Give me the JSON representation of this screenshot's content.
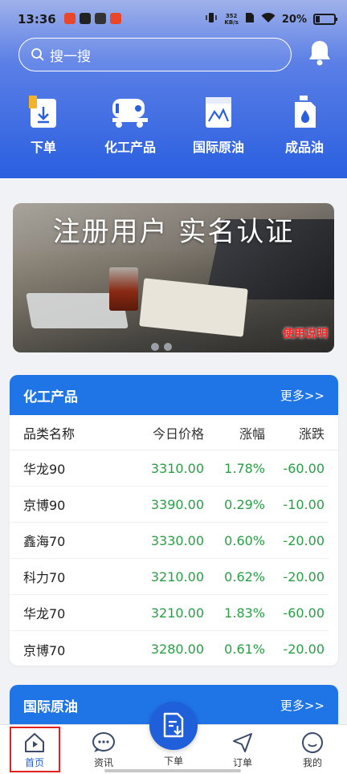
{
  "status_bar": {
    "time": "13:36",
    "net_speed": "352",
    "net_unit": "KB/s",
    "battery": "20%"
  },
  "search": {
    "placeholder": "搜一搜"
  },
  "quick_actions": [
    {
      "label": "下单",
      "icon": "order-document-icon"
    },
    {
      "label": "化工产品",
      "icon": "tanker-truck-icon"
    },
    {
      "label": "国际原油",
      "icon": "oil-chart-icon"
    },
    {
      "label": "成品油",
      "icon": "oil-can-icon"
    }
  ],
  "banner": {
    "title": "注册用户  实名认证",
    "guide_link": "使用说明"
  },
  "chemical": {
    "title": "化工产品",
    "more": "更多>>",
    "columns": [
      "品类名称",
      "今日价格",
      "涨幅",
      "涨跌"
    ],
    "rows": [
      {
        "name": "华龙90",
        "price": "3310.00",
        "pct": "1.78%",
        "change": "-60.00"
      },
      {
        "name": "京博90",
        "price": "3390.00",
        "pct": "0.29%",
        "change": "-10.00"
      },
      {
        "name": "鑫海70",
        "price": "3330.00",
        "pct": "0.60%",
        "change": "-20.00"
      },
      {
        "name": "科力70",
        "price": "3210.00",
        "pct": "0.62%",
        "change": "-20.00"
      },
      {
        "name": "华龙70",
        "price": "3210.00",
        "pct": "1.83%",
        "change": "-60.00"
      },
      {
        "name": "京博70",
        "price": "3280.00",
        "pct": "0.61%",
        "change": "-20.00"
      }
    ]
  },
  "crude": {
    "title": "国际原油",
    "more": "更多>>"
  },
  "nav": {
    "home": "首页",
    "news": "资讯",
    "order": "下单",
    "orders": "订单",
    "mine": "我的"
  },
  "colors": {
    "accent": "#1f74e6",
    "up_text": "#27a043",
    "highlight": "#e0211d"
  }
}
